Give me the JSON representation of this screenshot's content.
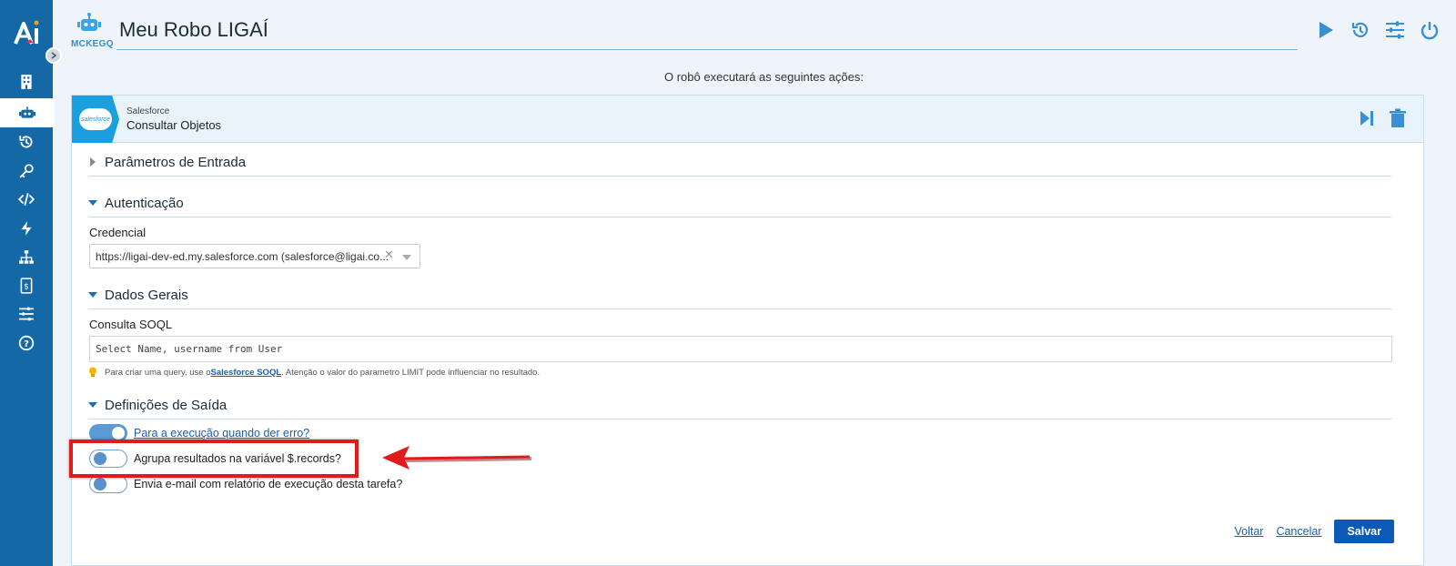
{
  "header": {
    "robot_code": "MCKEGQ",
    "title": "Meu Robo LIGAÍ",
    "subtitle": "O robô executará as seguintes ações:"
  },
  "step": {
    "provider": "Salesforce",
    "name": "Consultar Objetos",
    "logo_text": "salesforce"
  },
  "sections": {
    "input_params": "Parâmetros de Entrada",
    "auth": "Autenticação",
    "general": "Dados Gerais",
    "output": "Definições de Saída"
  },
  "auth": {
    "credential_label": "Credencial",
    "credential_value": "https://ligai-dev-ed.my.salesforce.com (salesforce@ligai.co..."
  },
  "general": {
    "soql_label": "Consulta SOQL",
    "soql_value": "Select Name, username from User",
    "hint_prefix": "Para criar uma query, use o",
    "hint_link": "Salesforce SOQL",
    "hint_suffix": ". Atenção o valor do parametro LIMIT pode influenciar no resultado."
  },
  "output": {
    "toggles": [
      {
        "label": "Para a execução quando der erro?",
        "on": true
      },
      {
        "label": "Agrupa resultados na variável $.records?",
        "on": false
      },
      {
        "label": "Envia e-mail com relatório de execução desta tarefa?",
        "on": false
      }
    ]
  },
  "footer": {
    "back": "Voltar",
    "cancel": "Cancelar",
    "save": "Salvar"
  },
  "colors": {
    "sidebar": "#1468a6",
    "accent": "#1a5fb4",
    "highlight": "#e01b1b"
  },
  "icons": {
    "sidebar": [
      "building-icon",
      "robot-icon",
      "history-icon",
      "key-icon",
      "code-icon",
      "bolt-icon",
      "sitemap-icon",
      "invoice-icon",
      "sliders-icon",
      "help-icon"
    ],
    "header": [
      "play-icon",
      "history-icon",
      "sliders-icon",
      "power-icon"
    ]
  }
}
